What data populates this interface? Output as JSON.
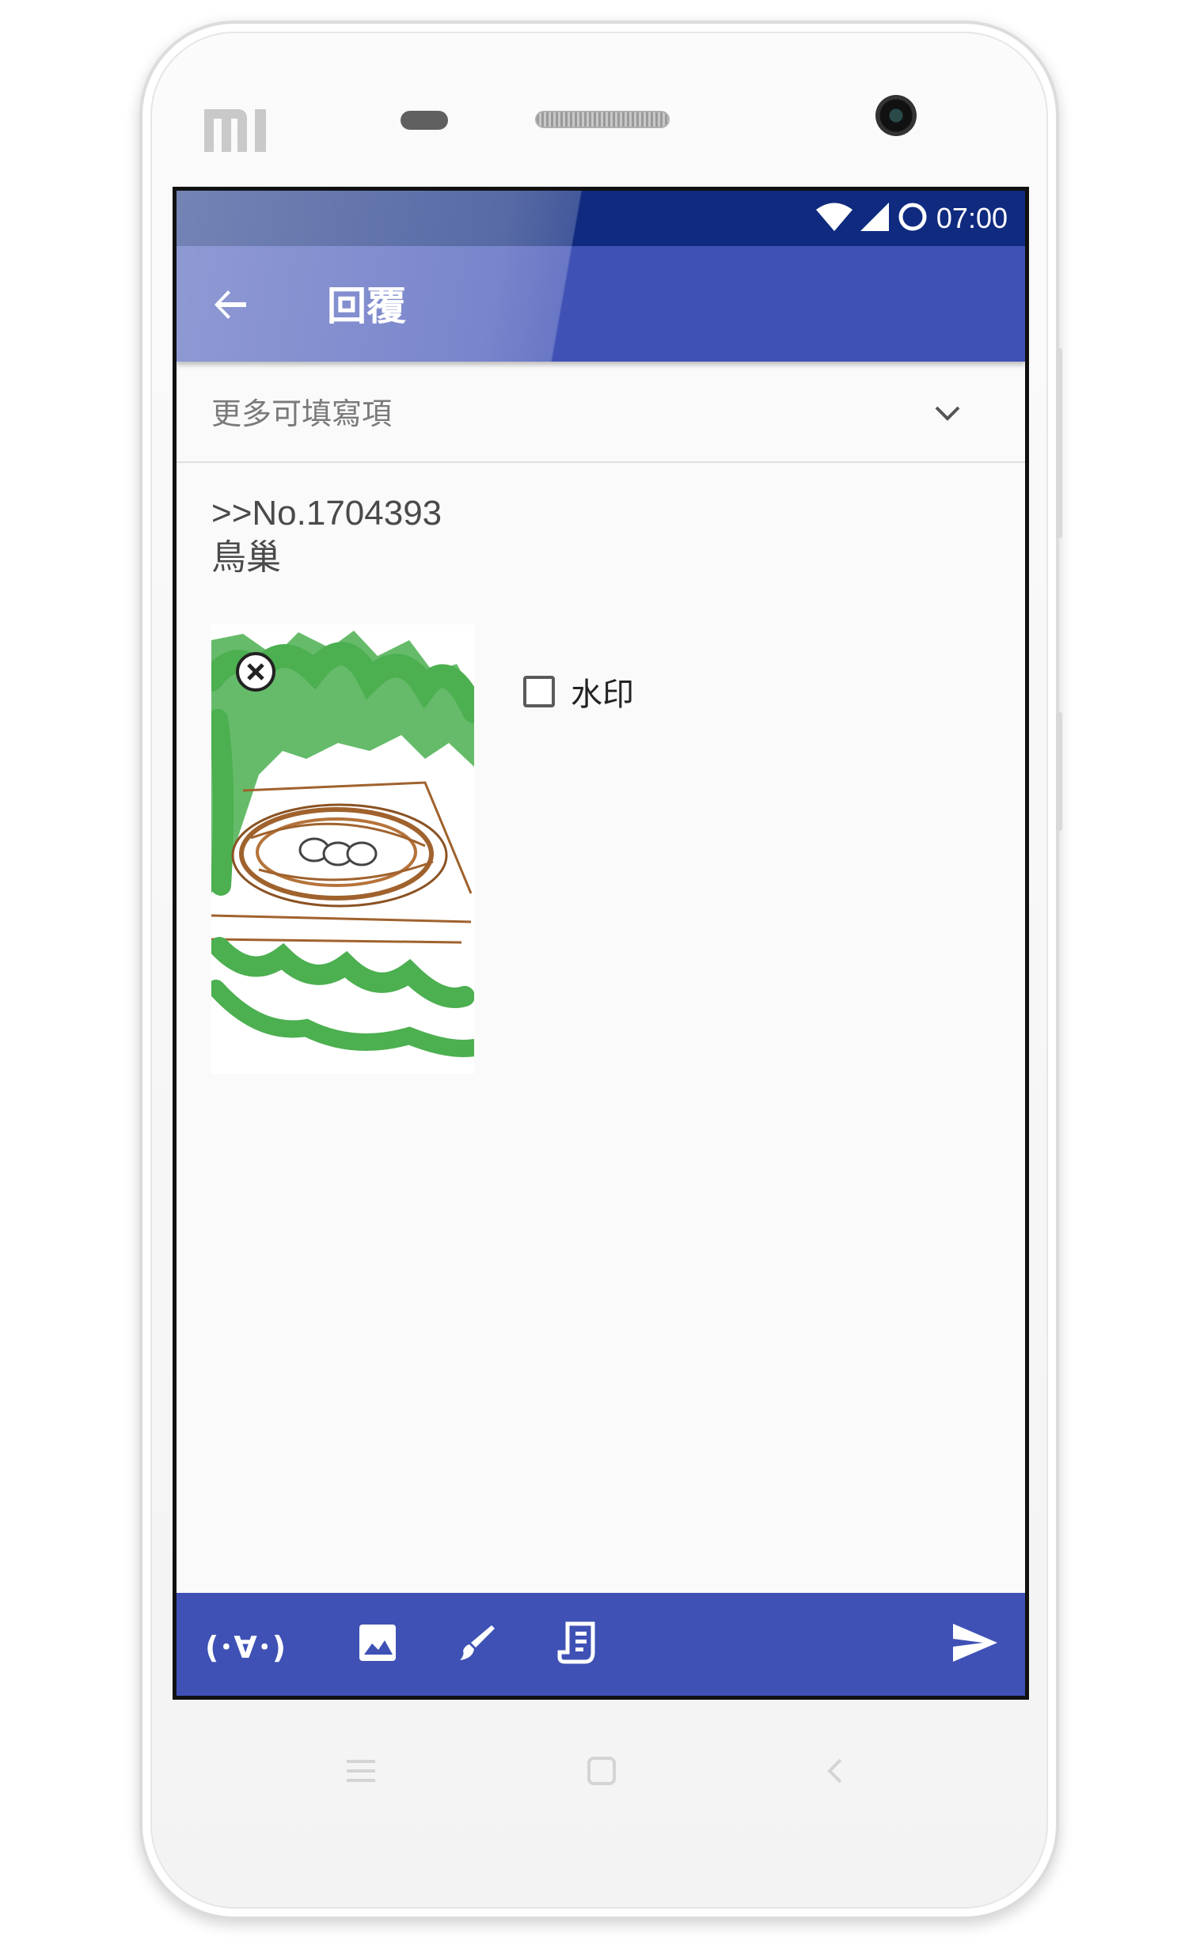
{
  "status_bar": {
    "time": "07:00",
    "icons": [
      "wifi-icon",
      "cell-signal-icon",
      "circle-icon"
    ]
  },
  "app_bar": {
    "title": "回覆",
    "back_icon": "arrow-left-icon"
  },
  "more_fields": {
    "label": "更多可填寫項",
    "icon": "chevron-down-icon"
  },
  "reply": {
    "quote": ">>No.1704393",
    "body": "鳥巢"
  },
  "attachment": {
    "image": "drawing-bird-nest",
    "remove_icon": "close-circle-icon"
  },
  "watermark": {
    "label": "水印",
    "checked": false
  },
  "toolbar": {
    "kaomoji_label": "(･∀･)",
    "icons": [
      "image-icon",
      "brush-icon",
      "doodle-icon",
      "send-icon"
    ]
  },
  "colors": {
    "primary": "#3f51b5",
    "status_dark": "#0f2a7f",
    "green": "#4caf50",
    "brown": "#a0622d"
  },
  "phone": {
    "brand": "MI",
    "nav_keys": [
      "menu-icon",
      "home-icon",
      "back-icon"
    ]
  }
}
